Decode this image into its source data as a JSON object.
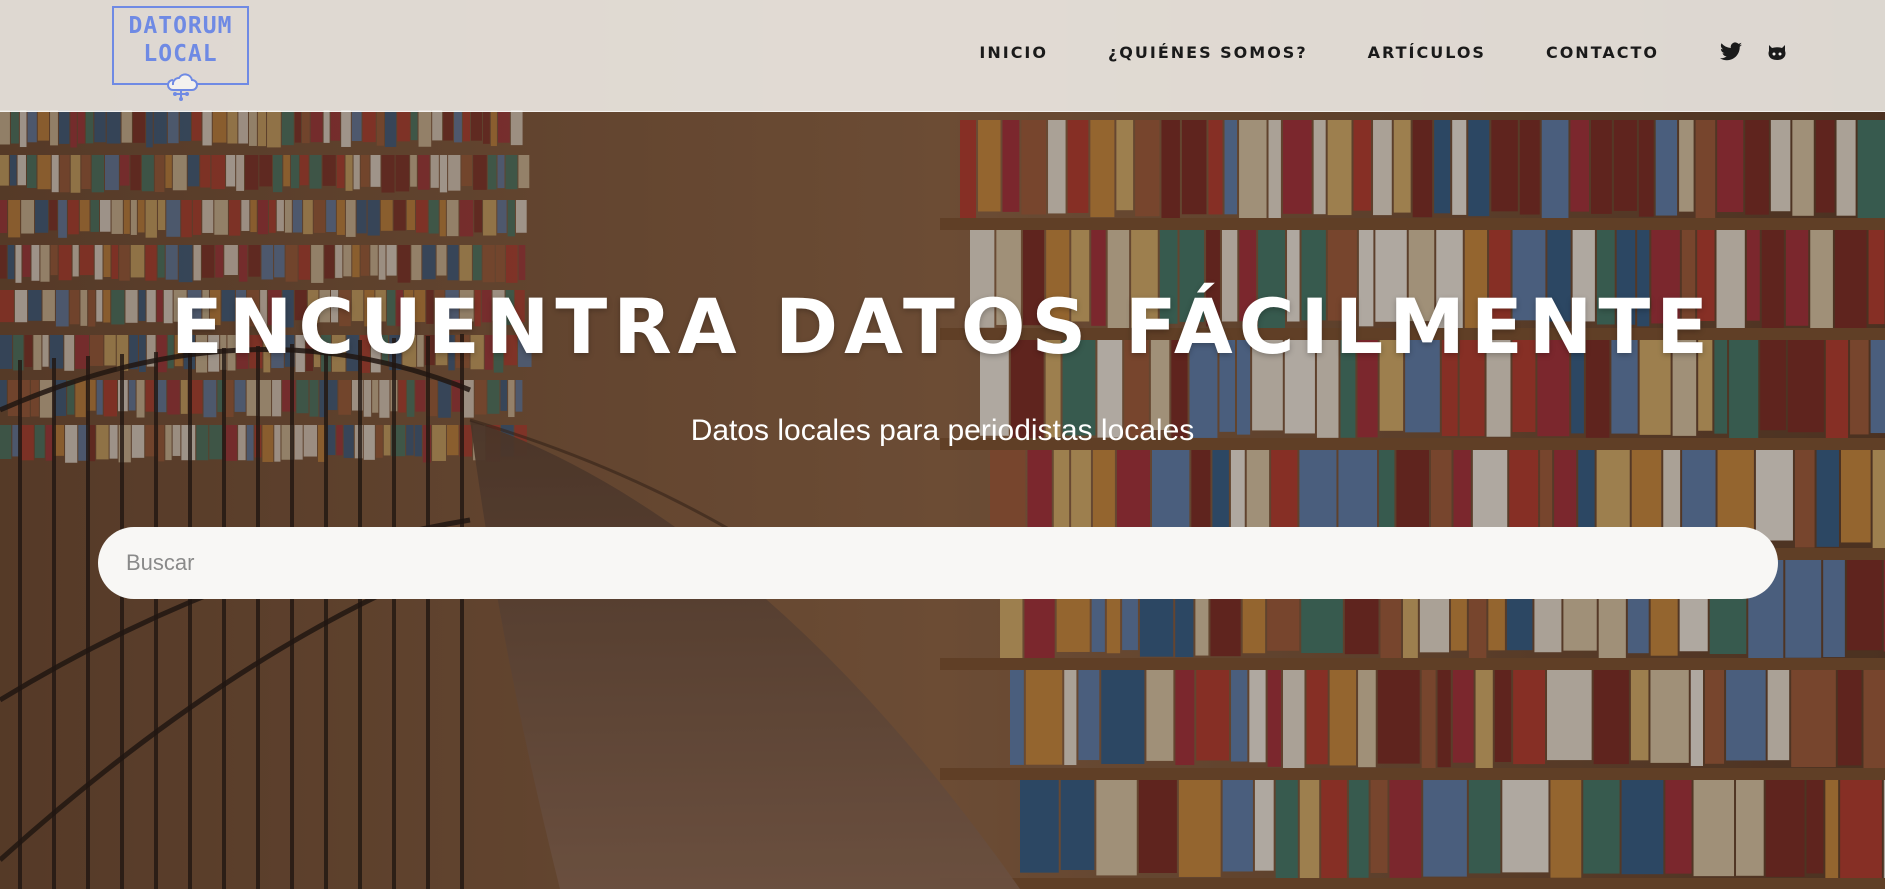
{
  "logo": {
    "line1": "DATORUM",
    "line2": "LOCAL",
    "icon": "cloud-network-icon",
    "color": "#6f8ae4"
  },
  "nav": {
    "items": [
      {
        "label": "INICIO"
      },
      {
        "label": "¿QUIÉNES SOMOS?"
      },
      {
        "label": "ARTÍCULOS"
      },
      {
        "label": "CONTACTO"
      }
    ],
    "social": [
      {
        "icon": "twitter-icon"
      },
      {
        "icon": "github-icon"
      }
    ]
  },
  "hero": {
    "title": "ENCUENTRA DATOS FÁCILMENTE",
    "subtitle": "Datos locales para periodistas locales",
    "background": "library-bookshelves-photo"
  },
  "search": {
    "placeholder": "Buscar",
    "value": ""
  }
}
